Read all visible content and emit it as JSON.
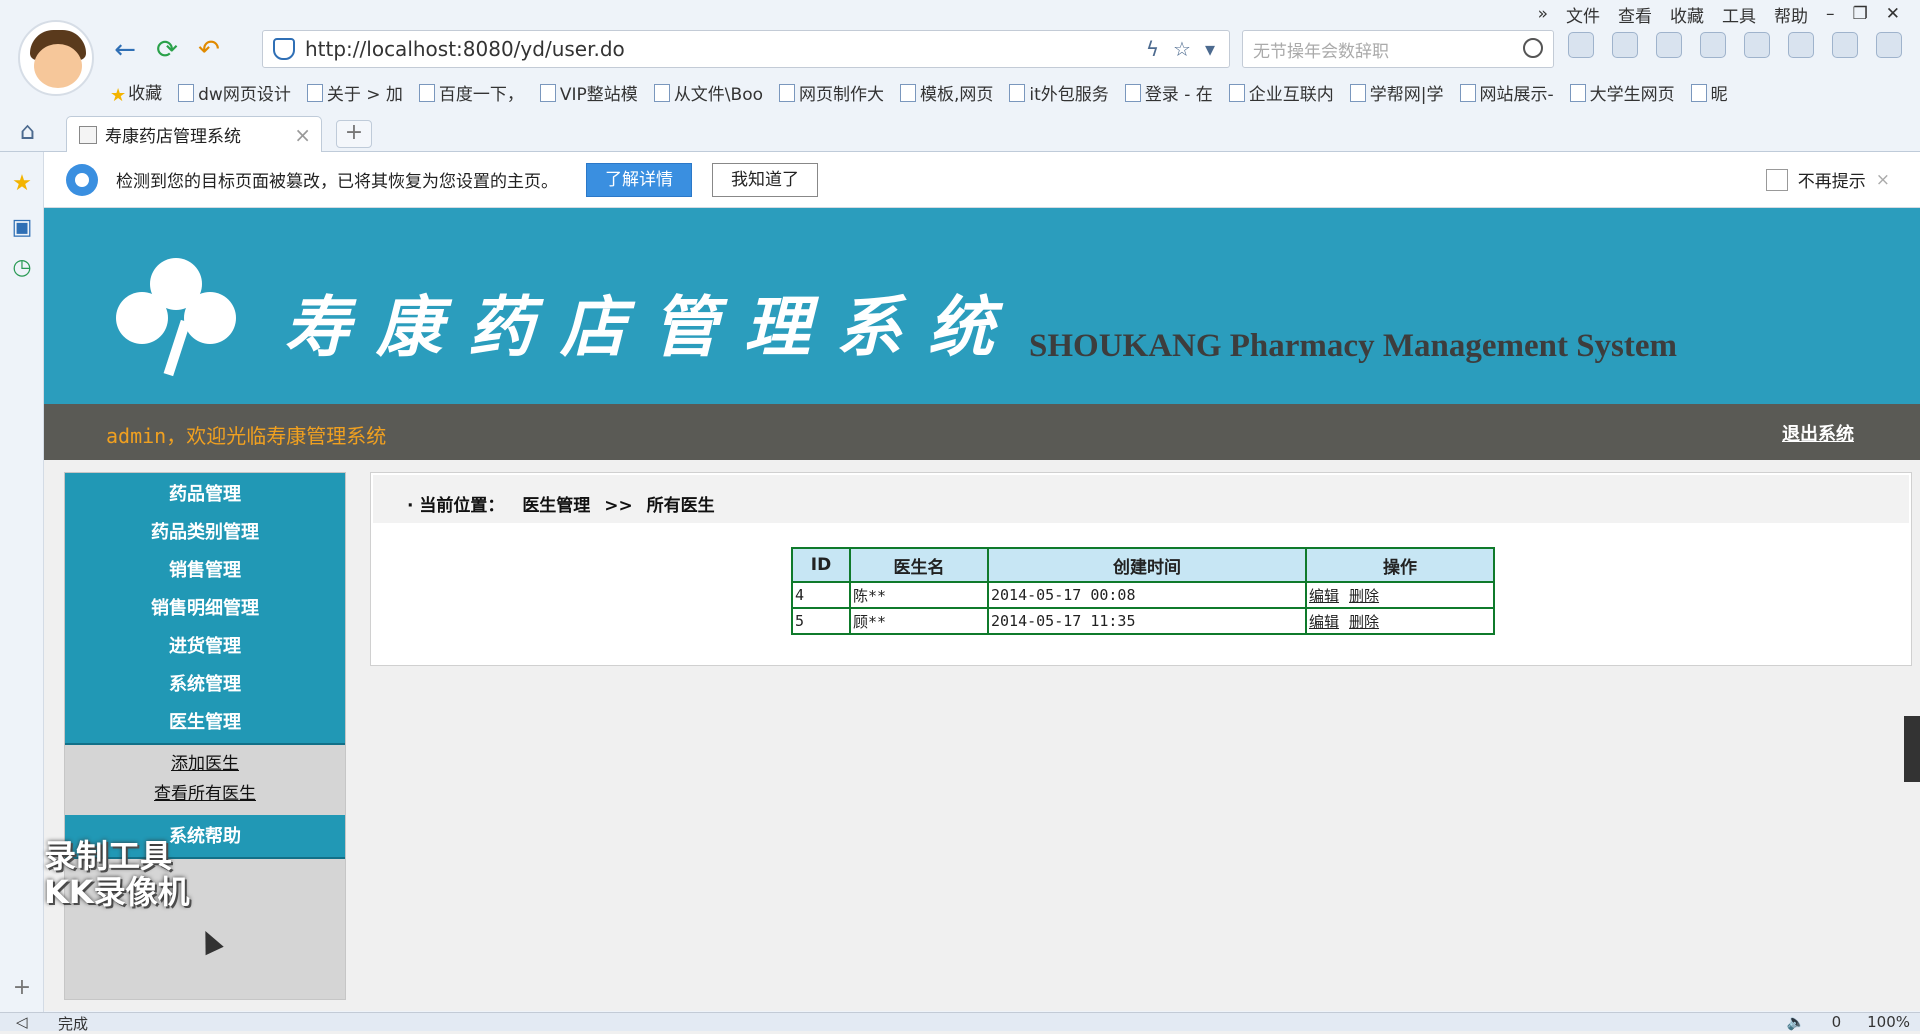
{
  "browser": {
    "menu": [
      "»",
      "文件",
      "查看",
      "收藏",
      "工具",
      "帮助"
    ],
    "address_url": "http://localhost:8080/yd/user.do",
    "search_placeholder": "无节操年会数辞职",
    "bookmarks": [
      "收藏",
      "dw网页设计",
      "关于 > 加",
      "百度一下，",
      "VIP整站模",
      "从文件\\Boo",
      "网页制作大",
      "模板,网页",
      "it外包服务",
      "登录 - 在",
      "企业互联内",
      "学帮网|学",
      "网站展示-",
      "大学生网页",
      "昵"
    ],
    "tab_title": "寿康药店管理系统",
    "notice_message": "检测到您的目标页面被篡改，已将其恢复为您设置的主页。",
    "notice_learn_more": "了解详情",
    "notice_ok": "我知道了",
    "notice_no_remind": "不再提示",
    "status_left": "完成",
    "status_right": [
      "0",
      "100%"
    ]
  },
  "app": {
    "title_cn": "寿康药店管理系统",
    "title_en": "SHOUKANG Pharmacy Management System",
    "welcome_user": "admin",
    "welcome_text": "，欢迎光临寿康管理系统",
    "logout": "退出系统",
    "sidebar": {
      "items": [
        "药品管理",
        "药品类别管理",
        "销售管理",
        "销售明细管理",
        "进货管理",
        "系统管理",
        "医生管理",
        "系统帮助"
      ],
      "subitems": [
        "添加医生",
        "查看所有医生"
      ]
    },
    "breadcrumb": {
      "prefix": "· 当前位置：",
      "section": "医生管理",
      "sep": ">>",
      "page": "所有医生"
    },
    "table": {
      "headers": [
        "ID",
        "医生名",
        "创建时间",
        "操作"
      ],
      "rows": [
        {
          "id": "4",
          "name": "陈**",
          "created": "2014-05-17 00:08",
          "edit": "编辑",
          "delete": "删除"
        },
        {
          "id": "5",
          "name": "顾**",
          "created": "2014-05-17 11:35",
          "edit": "编辑",
          "delete": "删除"
        }
      ]
    }
  },
  "watermark": [
    "录制工具",
    "KK录像机"
  ]
}
